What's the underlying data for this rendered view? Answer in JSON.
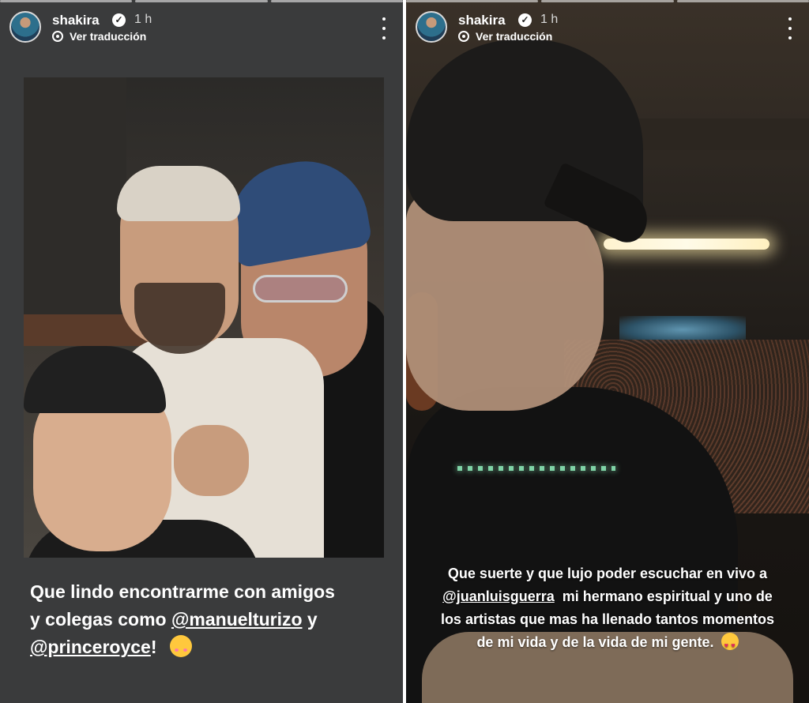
{
  "stories": [
    {
      "username": "shakira",
      "time": "1 h",
      "translate_label": "Ver traducción",
      "caption": {
        "line1": "Que lindo encontrarme con amigos",
        "line2_prefix": "y colegas como ",
        "mention1": "@manuelturizo",
        "line2_suffix": " y",
        "mention2": "@princeroyce",
        "line3_suffix": "!"
      }
    },
    {
      "username": "shakira",
      "time": "1 h",
      "translate_label": "Ver traducción",
      "caption": {
        "line1": "Que suerte y que lujo poder escuchar en vivo a",
        "mention": "@juanluisguerra",
        "line2_suffix": "  mi hermano espiritual y uno de",
        "line3": "los artistas que mas ha llenado tantos momentos",
        "line4": "de mi vida y de la vida de mi gente."
      }
    }
  ],
  "icons": {
    "verified": "verified-badge-icon",
    "translate": "translate-icon",
    "more": "more-options-icon",
    "emoji_left": "smiling-face-with-hearts-emoji",
    "emoji_right": "heart-eyes-emoji"
  },
  "colors": {
    "left_background": "#3a3b3c",
    "text": "#ffffff"
  }
}
